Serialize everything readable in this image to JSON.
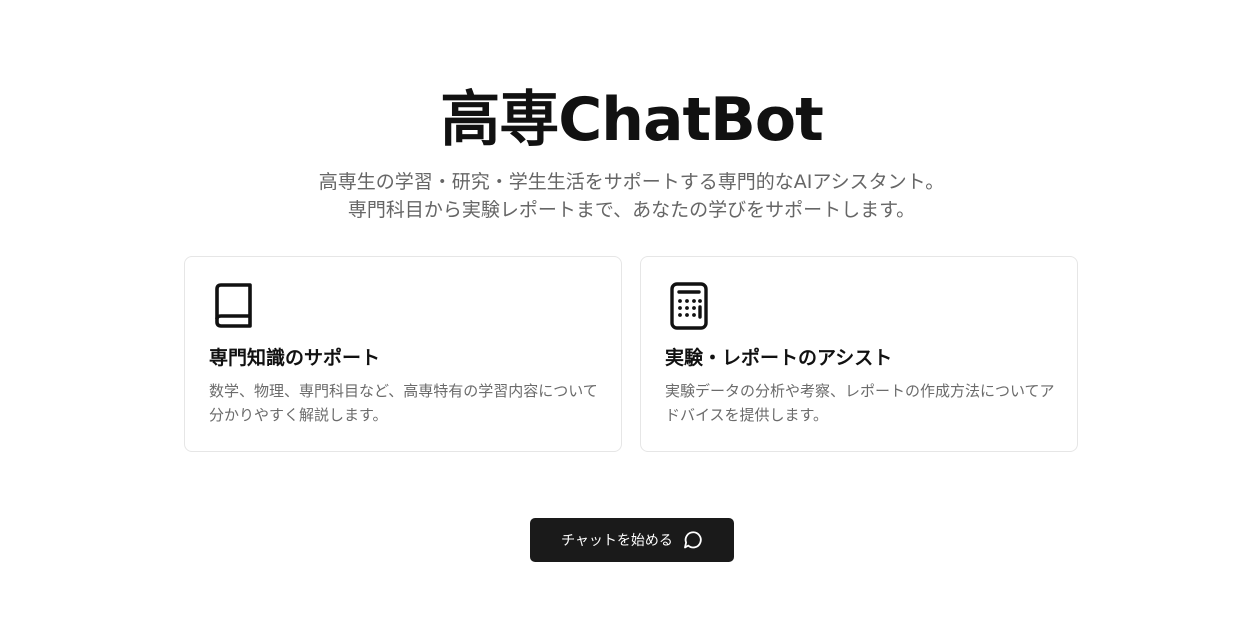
{
  "hero": {
    "title": "高専ChatBot",
    "subtitle_line1": "高専生の学習・研究・学生生活をサポートする専門的なAIアシスタント。",
    "subtitle_line2": "専門科目から実験レポートまで、あなたの学びをサポートします。"
  },
  "features": [
    {
      "icon": "book-icon",
      "title": "専門知識のサポート",
      "description": "数学、物理、専門科目など、高専特有の学習内容について分かりやすく解説します。"
    },
    {
      "icon": "calculator-icon",
      "title": "実験・レポートのアシスト",
      "description": "実験データの分析や考察、レポートの作成方法についてアドバイスを提供します。"
    }
  ],
  "cta": {
    "label": "チャットを始める",
    "icon": "chat-bubble-icon"
  },
  "colors": {
    "background": "#ffffff",
    "text_primary": "#111111",
    "text_secondary": "#666666",
    "card_border": "#e6e6e6",
    "button_background": "#1a1a1a",
    "button_text": "#ffffff"
  }
}
